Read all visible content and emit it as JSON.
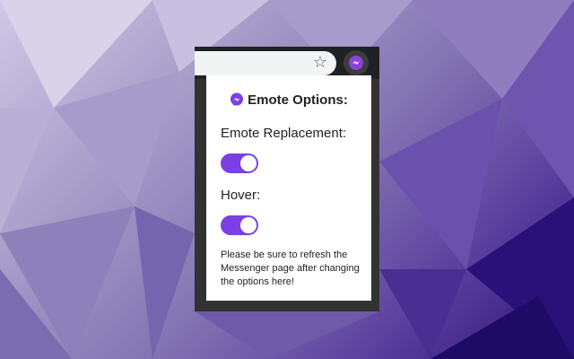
{
  "popup": {
    "title": "Emote Options:",
    "settings": [
      {
        "label": "Emote Replacement:",
        "enabled": true
      },
      {
        "label": "Hover:",
        "enabled": true
      }
    ],
    "note": "Please be sure to refresh the Messenger page after changing the options here!"
  },
  "icons": {
    "bookmark": "star-icon",
    "extension": "messenger-extension-icon",
    "header": "messenger-icon"
  },
  "colors": {
    "accent": "#7b3fe4"
  }
}
